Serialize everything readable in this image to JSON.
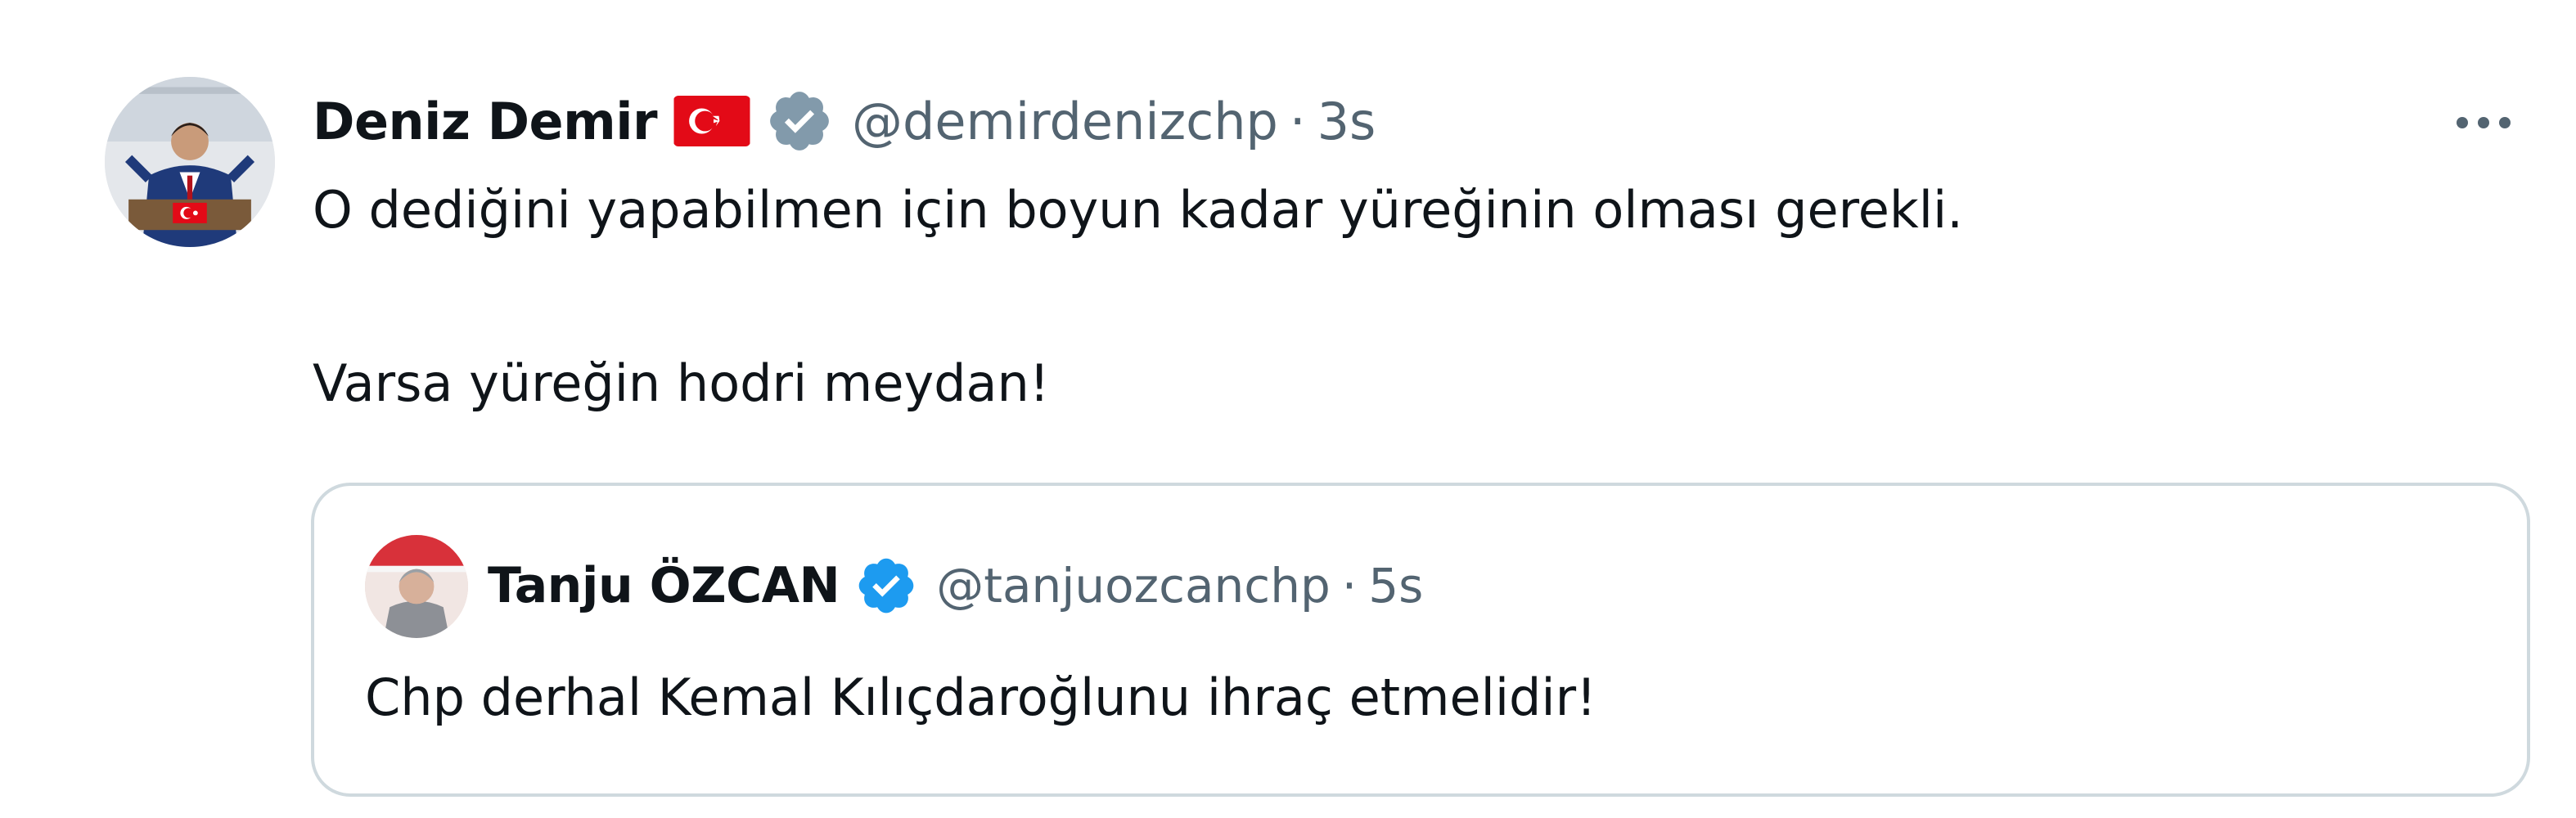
{
  "tweet": {
    "author": {
      "display_name": "Deniz Demir",
      "handle": "@demirdenizchp",
      "separator": "·",
      "time": "3s",
      "flag_icon": "turkey-flag-icon",
      "verified_icon": "verified-badge-icon",
      "verified_color": "#829aab"
    },
    "more_icon": "more-options-icon",
    "text_lines": [
      "O dediğini yapabilmen için boyun kadar yüreğinin olması gerekli.",
      "Varsa yüreğin hodri meydan!"
    ]
  },
  "quoted_tweet": {
    "author": {
      "display_name": "Tanju ÖZCAN",
      "handle": "@tanjuozcanchp",
      "separator": "·",
      "time": "5s",
      "verified_icon": "verified-badge-icon",
      "verified_color": "#1d9bf0"
    },
    "text": "Chp derhal Kemal Kılıçdaroğlunu ihraç etmelidir!"
  },
  "colors": {
    "text_primary": "#0f1419",
    "text_secondary": "#536471",
    "border": "#cfd9de",
    "flag_red": "#e30a17"
  }
}
